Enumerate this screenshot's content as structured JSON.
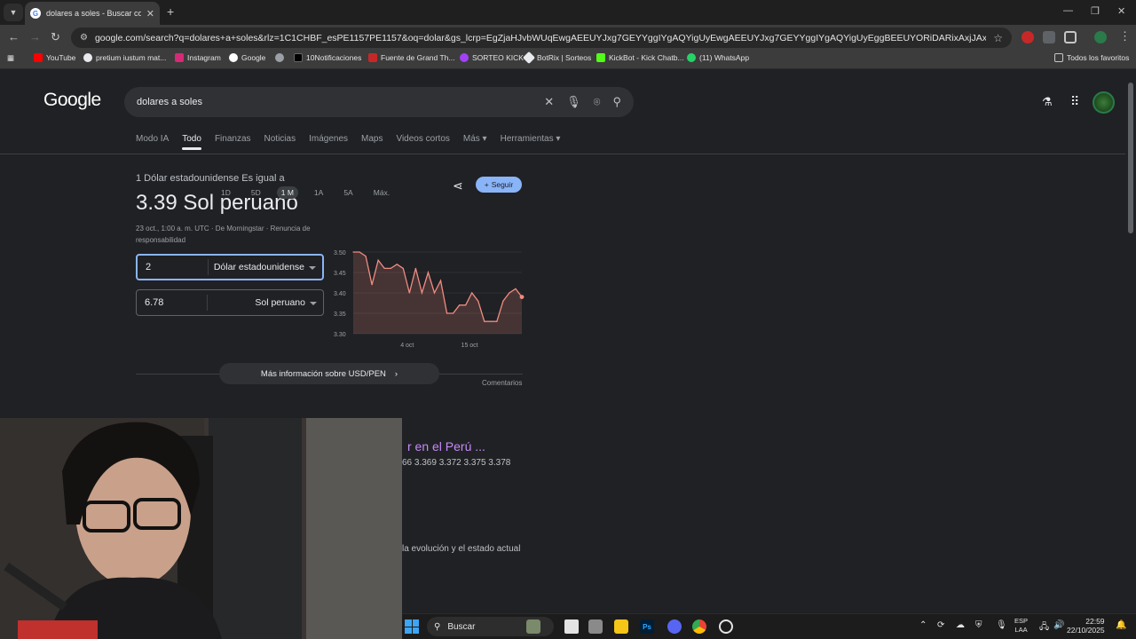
{
  "browser": {
    "tab_title": "dolares a soles - Buscar con Google",
    "url": "google.com/search?q=dolares+a+soles&rlz=1C1CHBF_esPE1157PE1157&oq=dolar&gs_lcrp=EgZjaHJvbWUqEwgAEEUYJxg7GEYYggIYgAQYigUyEwgAEEUYJxg7GEYYggIYgAQYigUyEggBEEUYORiDARixAxjJAxiABDIOCAIQRRgnGDsYgAQYiguyDQg...",
    "bookmarks": [
      "YouTube",
      "pretium iustum mat...",
      "Instagram",
      "Google",
      "",
      "10Notificaciones",
      "Fuente de Grand Th...",
      "SORTEO KICK",
      "BotRix | Sorteos",
      "KickBot - Kick Chatb...",
      "(11) WhatsApp"
    ],
    "all_favorites": "Todos los favoritos"
  },
  "google": {
    "logo": "Google",
    "query": "dolares a soles",
    "nav": [
      "Modo IA",
      "Todo",
      "Finanzas",
      "Noticias",
      "Imágenes",
      "Maps",
      "Videos cortos",
      "Más",
      "Herramientas"
    ],
    "active_nav": "Todo"
  },
  "converter": {
    "equals_label": "1 Dólar estadounidense Es igual a",
    "result": "3.39 Sol peruano",
    "meta": "23 oct., 1:00 a. m. UTC · De Morningstar · Renuncia de responsabilidad",
    "follow_label": "Seguir",
    "from_value": "2",
    "from_currency": "Dólar estadounidense",
    "to_value": "6.78",
    "to_currency": "Sol peruano",
    "ranges": [
      "1D",
      "5D",
      "1 M",
      "1A",
      "5A",
      "Máx."
    ],
    "selected_range": "1 M",
    "more_info": "Más información sobre USD/PEN",
    "comments": "Comentarios"
  },
  "result_snippet": {
    "title": "r en el Perú ...",
    "line1": "66 3.369 3.372 3.375 3.378",
    "line2": "la evolución y el estado actual"
  },
  "chart_data": {
    "type": "area",
    "yticks": [
      "3.50",
      "3.45",
      "3.40",
      "3.35",
      "3.30"
    ],
    "ylim": [
      3.3,
      3.5
    ],
    "xticks": [
      "4 oct",
      "15 oct"
    ],
    "color": "#f28b82",
    "values": [
      3.5,
      3.5,
      3.49,
      3.42,
      3.48,
      3.46,
      3.46,
      3.47,
      3.46,
      3.4,
      3.46,
      3.4,
      3.45,
      3.4,
      3.43,
      3.35,
      3.35,
      3.37,
      3.37,
      3.4,
      3.38,
      3.33,
      3.33,
      3.33,
      3.38,
      3.4,
      3.41,
      3.39
    ]
  },
  "taskbar": {
    "search_placeholder": "Buscar",
    "lang": "ESP",
    "lang2": "LAA",
    "time": "22:59",
    "date": "22/10/2025"
  }
}
